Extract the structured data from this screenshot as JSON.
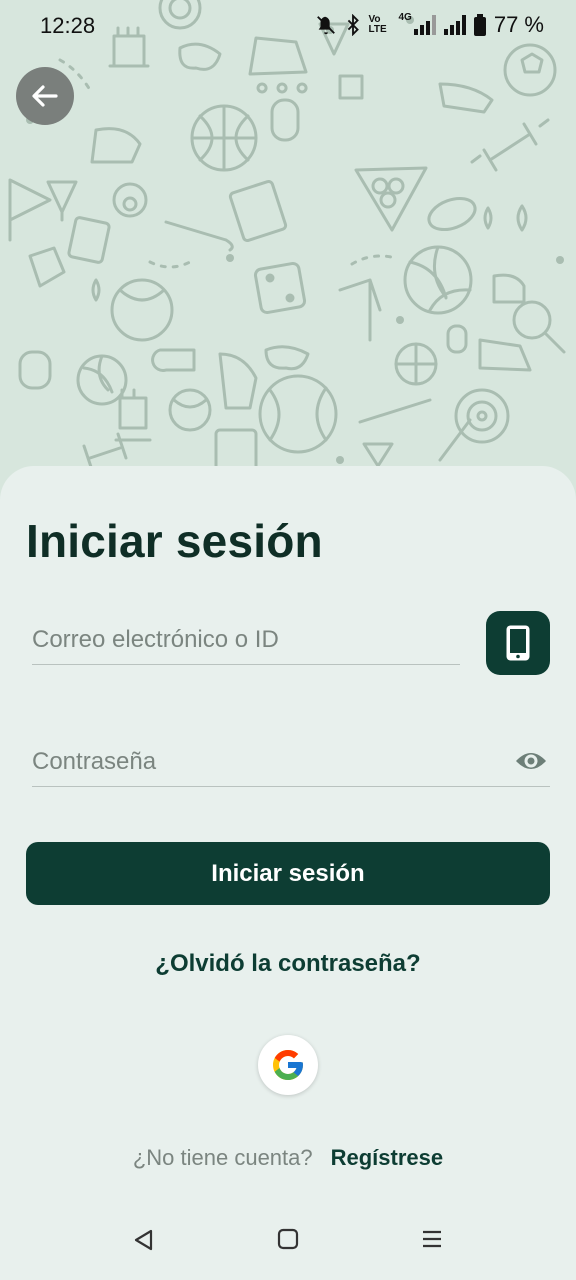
{
  "status_bar": {
    "time": "12:28",
    "battery_percent": "77 %",
    "network_label": "4G",
    "volte_label": "Vo LTE"
  },
  "auth": {
    "title": "Iniciar sesión",
    "email_placeholder": "Correo electrónico o ID",
    "password_placeholder": "Contraseña",
    "login_button": "Iniciar sesión",
    "forgot_password": "¿Olvidó la contraseña?",
    "no_account": "¿No tiene cuenta?",
    "register_link": "Regístrese"
  },
  "colors": {
    "primary": "#0d3d33",
    "background": "#e8f0ed",
    "hero_background": "#d7e6dd",
    "muted_text": "#7b8580"
  },
  "icons": {
    "back": "arrow-left-icon",
    "phone": "smartphone-icon",
    "password_visibility": "eye-icon",
    "google": "google-logo-icon",
    "nav_back": "triangle-back-icon",
    "nav_home": "square-home-icon",
    "nav_menu": "hamburger-menu-icon"
  }
}
